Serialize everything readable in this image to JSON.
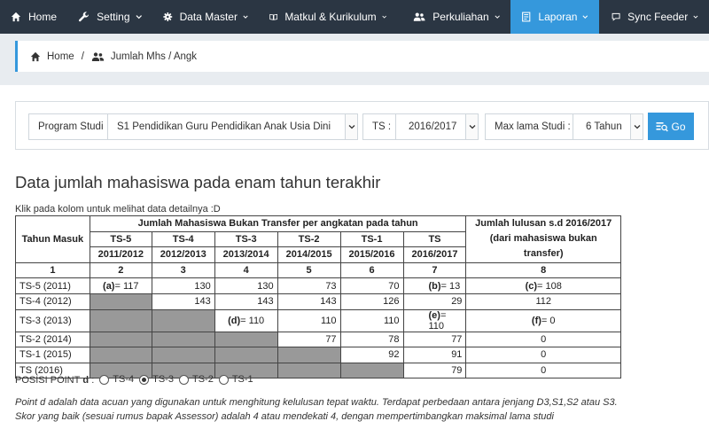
{
  "nav": {
    "items": [
      {
        "label": "Home",
        "icon": "home-icon",
        "has_chevron": false
      },
      {
        "label": "Setting",
        "icon": "wrench-icon",
        "has_chevron": true
      },
      {
        "label": "Data Master",
        "icon": "gear-icon",
        "has_chevron": true
      },
      {
        "label": "Matkul & Kurikulum",
        "icon": "book-icon",
        "has_chevron": true
      },
      {
        "label": "Perkuliahan",
        "icon": "users-icon",
        "has_chevron": true
      },
      {
        "label": "Laporan",
        "icon": "report-icon",
        "has_chevron": true,
        "active": true
      },
      {
        "label": "Sync Feeder",
        "icon": "comment-icon",
        "has_chevron": true
      }
    ]
  },
  "breadcrumb": {
    "home": "Home",
    "separator": "/",
    "current": "Jumlah Mhs / Angk"
  },
  "filter": {
    "program_label": "Program Studi",
    "program_value": "S1 Pendidikan Guru Pendidikan Anak Usia Dini",
    "ts_label": "TS :",
    "ts_value": "2016/2017",
    "max_label": "Max lama Studi :",
    "max_value": "6 Tahun",
    "go_label": "Go"
  },
  "page_title": "Data jumlah mahasiswa pada enam tahun terakhir",
  "hint": "Klik pada kolom untuk melihat data detailnya :D",
  "table": {
    "col_tahun": "Tahun Masuk",
    "group_header": "Jumlah Mahasiswa Bukan Transfer per angkatan pada tahun",
    "lulusan_header_1": "Jumlah lulusan s.d 2016/2017",
    "lulusan_header_2": "(dari mahasiswa bukan transfer)",
    "ts_cols": [
      {
        "code": "TS-5",
        "year": "2011/2012"
      },
      {
        "code": "TS-4",
        "year": "2012/2013"
      },
      {
        "code": "TS-3",
        "year": "2013/2014"
      },
      {
        "code": "TS-2",
        "year": "2014/2015"
      },
      {
        "code": "TS-1",
        "year": "2015/2016"
      },
      {
        "code": "TS",
        "year": "2016/2017"
      }
    ],
    "col_numbers": [
      "1",
      "2",
      "3",
      "4",
      "5",
      "6",
      "7",
      "8"
    ],
    "rows": [
      {
        "label": "TS-5 (2011)",
        "cells": [
          {
            "tag": "(a)",
            "value": "= 117",
            "gray": false,
            "align": "ctr"
          },
          {
            "value": "130"
          },
          {
            "value": "130"
          },
          {
            "value": "73"
          },
          {
            "value": "70"
          },
          {
            "tag": "(b)",
            "value": "= 13",
            "align": "left"
          }
        ],
        "lulusan": {
          "tag": "(c)",
          "value": "= 108"
        }
      },
      {
        "label": "TS-4 (2012)",
        "cells": [
          {
            "gray": true
          },
          {
            "value": "143"
          },
          {
            "value": "143"
          },
          {
            "value": "143"
          },
          {
            "value": "126"
          },
          {
            "value": "29"
          }
        ],
        "lulusan": {
          "value": "112"
        }
      },
      {
        "label": "TS-3 (2013)",
        "cells": [
          {
            "gray": true
          },
          {
            "gray": true
          },
          {
            "tag": "(d)",
            "value": "= 110",
            "align": "ctr"
          },
          {
            "value": "110"
          },
          {
            "value": "110"
          },
          {
            "tag": "(e)",
            "value": "= 110",
            "align": "left"
          }
        ],
        "lulusan": {
          "tag": "(f)",
          "value": "= 0"
        }
      },
      {
        "label": "TS-2 (2014)",
        "cells": [
          {
            "gray": true
          },
          {
            "gray": true
          },
          {
            "gray": true
          },
          {
            "value": "77"
          },
          {
            "value": "78"
          },
          {
            "value": "77"
          }
        ],
        "lulusan": {
          "value": "0"
        }
      },
      {
        "label": "TS-1 (2015)",
        "cells": [
          {
            "gray": true
          },
          {
            "gray": true
          },
          {
            "gray": true
          },
          {
            "gray": true
          },
          {
            "value": "92"
          },
          {
            "value": "91"
          }
        ],
        "lulusan": {
          "value": "0"
        }
      },
      {
        "label": "TS (2016)",
        "cells": [
          {
            "gray": true
          },
          {
            "gray": true
          },
          {
            "gray": true
          },
          {
            "gray": true
          },
          {
            "gray": true
          },
          {
            "value": "79"
          }
        ],
        "lulusan": {
          "value": "0"
        }
      }
    ]
  },
  "posisi": {
    "label": "POSISI POINT",
    "letter": "d",
    "colon": ":",
    "options": [
      {
        "label": "TS-4",
        "checked": false
      },
      {
        "label": "TS-3",
        "checked": true
      },
      {
        "label": "TS-2",
        "checked": false
      },
      {
        "label": "TS-1",
        "checked": false
      }
    ]
  },
  "note": {
    "line1": "Point d adalah data acuan yang digunakan untuk menghitung kelulusan tepat waktu. Terdapat perbedaan antara jenjang D3,S1,S2 atau S3.",
    "line2": "Skor yang baik (sesuai rumus bapak Assessor) adalah 4 atau mendekati 4, dengan mempertimbangkan maksimal lama studi"
  }
}
